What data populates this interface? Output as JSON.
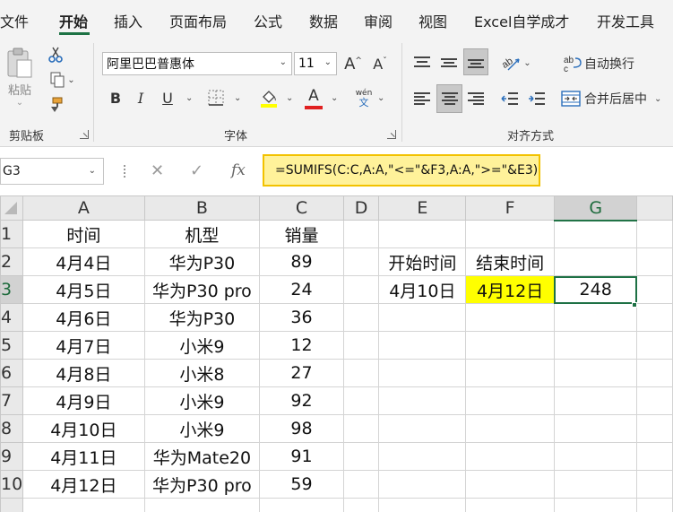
{
  "ribbon_tabs": [
    "文件",
    "开始",
    "插入",
    "页面布局",
    "公式",
    "数据",
    "审阅",
    "视图",
    "Excel自学成才",
    "开发工具"
  ],
  "active_tab": "开始",
  "clipboard": {
    "paste_label": "粘贴",
    "group_label": "剪贴板"
  },
  "font": {
    "name": "阿里巴巴普惠体",
    "size": "11",
    "bold": "B",
    "italic": "I",
    "underline": "U",
    "font_color_letter": "A",
    "wen_top": "wén",
    "wen_bottom": "文",
    "group_label": "字体"
  },
  "alignment": {
    "wrap_text": "自动换行",
    "merge_center": "合并后居中",
    "group_label": "对齐方式"
  },
  "colors": {
    "accent": "#217346",
    "highlight": "#ffff00",
    "formula_highlight": "#fff29a",
    "font_color": "#e02020",
    "fill_color": "#ffff00"
  },
  "formula_bar": {
    "name_box": "G3",
    "formula": "=SUMIFS(C:C,A:A,\"<=\"&F3,A:A,\">=\"&E3)",
    "fx": "fx"
  },
  "columns": [
    "A",
    "B",
    "C",
    "D",
    "E",
    "F",
    "G"
  ],
  "rows": [
    {
      "num": "1",
      "cells": [
        "时间",
        "机型",
        "销量",
        "",
        "",
        "",
        ""
      ]
    },
    {
      "num": "2",
      "cells": [
        "4月4日",
        "华为P30",
        "89",
        "",
        "开始时间",
        "结束时间",
        ""
      ]
    },
    {
      "num": "3",
      "cells": [
        "4月5日",
        "华为P30 pro",
        "24",
        "",
        "4月10日",
        "4月12日",
        "248"
      ]
    },
    {
      "num": "4",
      "cells": [
        "4月6日",
        "华为P30",
        "36",
        "",
        "",
        "",
        ""
      ]
    },
    {
      "num": "5",
      "cells": [
        "4月7日",
        "小米9",
        "12",
        "",
        "",
        "",
        ""
      ]
    },
    {
      "num": "6",
      "cells": [
        "4月8日",
        "小米8",
        "27",
        "",
        "",
        "",
        ""
      ]
    },
    {
      "num": "7",
      "cells": [
        "4月9日",
        "小米9",
        "92",
        "",
        "",
        "",
        ""
      ]
    },
    {
      "num": "8",
      "cells": [
        "4月10日",
        "小米9",
        "98",
        "",
        "",
        "",
        ""
      ]
    },
    {
      "num": "9",
      "cells": [
        "4月11日",
        "华为Mate20",
        "91",
        "",
        "",
        "",
        ""
      ]
    },
    {
      "num": "10",
      "cells": [
        "4月12日",
        "华为P30 pro",
        "59",
        "",
        "",
        "",
        ""
      ]
    },
    {
      "num": "",
      "cells": [
        "",
        "",
        "",
        "",
        "",
        "",
        ""
      ]
    }
  ]
}
